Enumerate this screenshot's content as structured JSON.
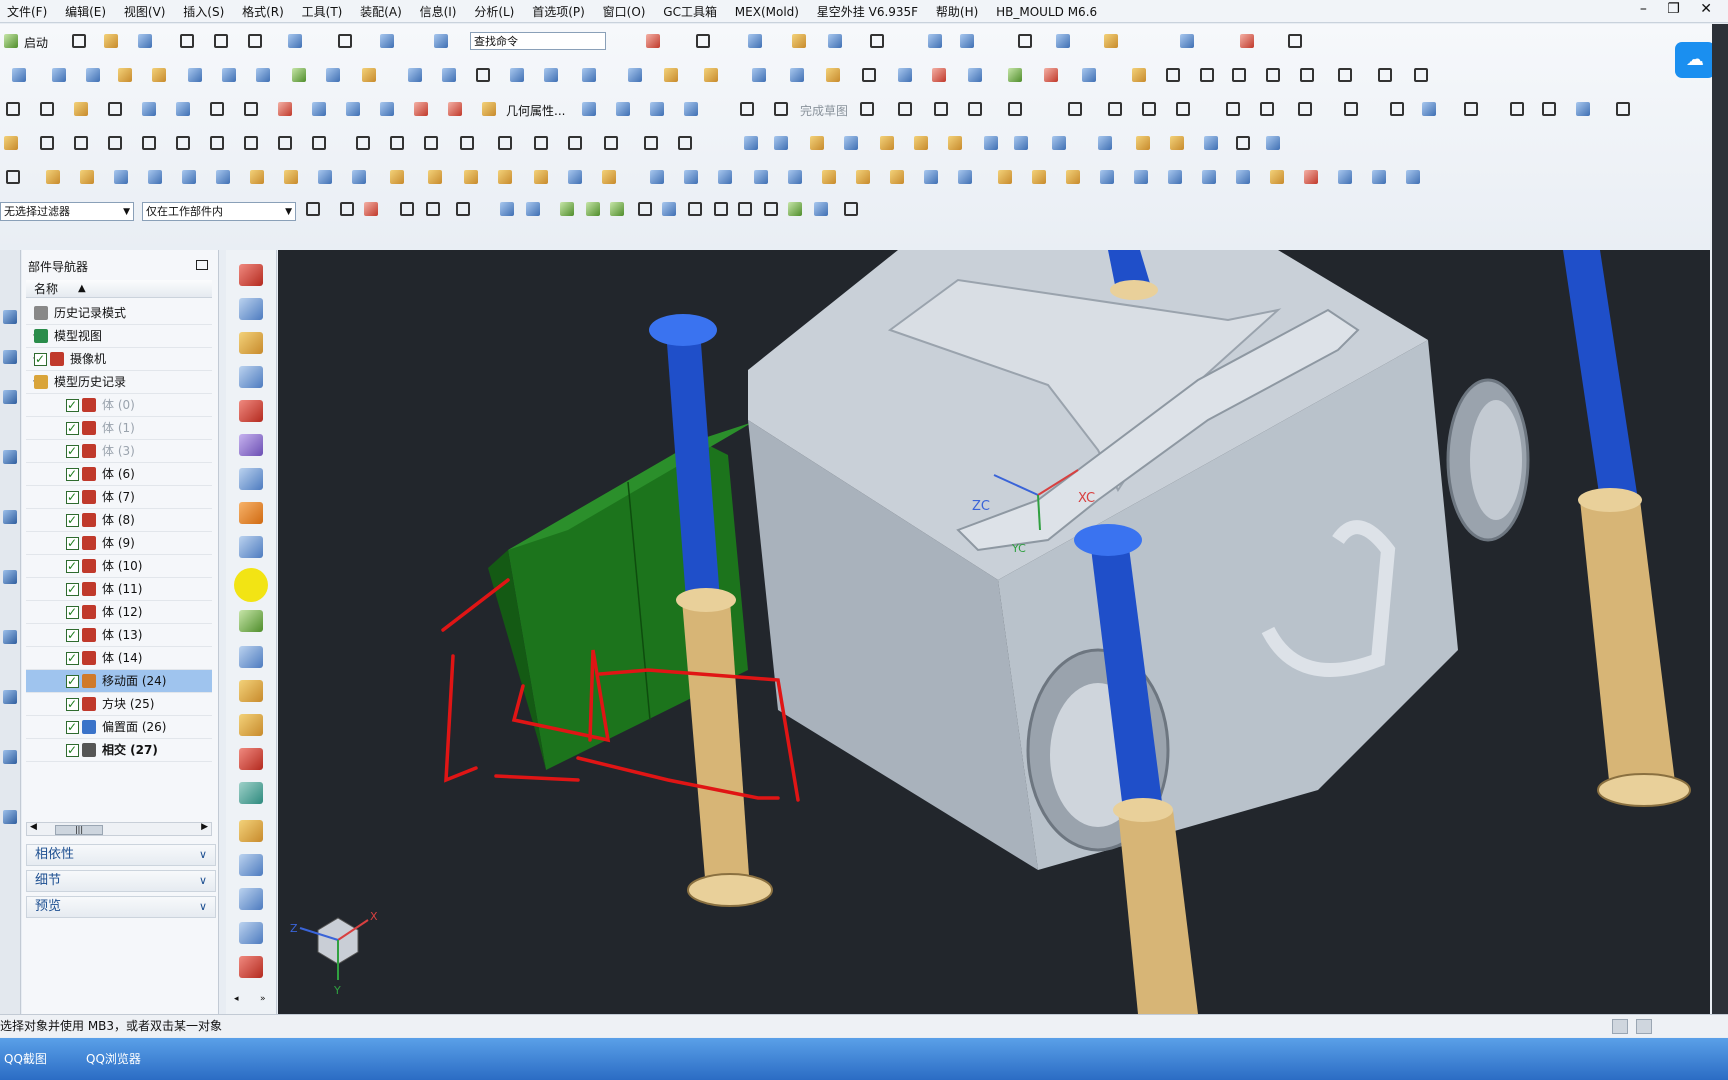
{
  "menu": {
    "items": [
      "文件(F)",
      "编辑(E)",
      "视图(V)",
      "插入(S)",
      "格式(R)",
      "工具(T)",
      "装配(A)",
      "信息(I)",
      "分析(L)",
      "首选项(P)",
      "窗口(O)",
      "GC工具箱",
      "MEX(Mold)",
      "星空外挂 V6.935F",
      "帮助(H)",
      "HB_MOULD M6.6"
    ],
    "window_controls": "– ❐ ✕"
  },
  "toolbar": {
    "start_label": "启动",
    "search_placeholder": "查找命令",
    "geometry_props_label": "几何属性...",
    "finish_sketch_label": "完成草图",
    "filter_select": "无选择过滤器",
    "scope_select": "仅在工作部件内"
  },
  "navigator": {
    "title": "部件导航器",
    "column_header": "名称",
    "sort_arrow": "▲",
    "rows": [
      {
        "label": "历史记录模式",
        "kind": "history",
        "indent": 0,
        "expand": "",
        "check": false,
        "dim": false
      },
      {
        "label": "模型视图",
        "kind": "view",
        "indent": 0,
        "expand": "+",
        "check": false,
        "dim": false
      },
      {
        "label": "摄像机",
        "kind": "camera",
        "indent": 0,
        "expand": "+",
        "check": true,
        "dim": false
      },
      {
        "label": "模型历史记录",
        "kind": "folder",
        "indent": 0,
        "expand": "−",
        "check": false,
        "dim": false
      },
      {
        "label": "体 (0)",
        "kind": "body",
        "indent": 1,
        "check": true,
        "dim": true
      },
      {
        "label": "体 (1)",
        "kind": "body",
        "indent": 1,
        "check": true,
        "dim": true
      },
      {
        "label": "体 (3)",
        "kind": "body",
        "indent": 1,
        "check": true,
        "dim": true
      },
      {
        "label": "体 (6)",
        "kind": "body",
        "indent": 1,
        "check": true,
        "dim": false
      },
      {
        "label": "体 (7)",
        "kind": "body",
        "indent": 1,
        "check": true,
        "dim": false
      },
      {
        "label": "体 (8)",
        "kind": "body",
        "indent": 1,
        "check": true,
        "dim": false
      },
      {
        "label": "体 (9)",
        "kind": "body",
        "indent": 1,
        "check": true,
        "dim": false
      },
      {
        "label": "体 (10)",
        "kind": "body",
        "indent": 1,
        "check": true,
        "dim": false
      },
      {
        "label": "体 (11)",
        "kind": "body",
        "indent": 1,
        "check": true,
        "dim": false
      },
      {
        "label": "体 (12)",
        "kind": "body",
        "indent": 1,
        "check": true,
        "dim": false
      },
      {
        "label": "体 (13)",
        "kind": "body",
        "indent": 1,
        "check": true,
        "dim": false
      },
      {
        "label": "体 (14)",
        "kind": "body",
        "indent": 1,
        "check": true,
        "dim": false
      },
      {
        "label": "移动面 (24)",
        "kind": "move",
        "indent": 1,
        "check": true,
        "dim": false,
        "selected": true
      },
      {
        "label": "方块 (25)",
        "kind": "block",
        "indent": 1,
        "check": true,
        "dim": false
      },
      {
        "label": "偏置面 (26)",
        "kind": "offset",
        "indent": 1,
        "check": true,
        "dim": false
      },
      {
        "label": "相交 (27)",
        "kind": "intersect",
        "indent": 1,
        "check": true,
        "dim": false,
        "bold": true
      }
    ],
    "sections": [
      "相依性",
      "细节",
      "预览"
    ]
  },
  "viewport": {
    "bg_color": "#22262c",
    "axis_labels": {
      "zc": "ZC",
      "xc": "XC",
      "yc": "YC"
    },
    "triad_labels": {
      "x": "X",
      "y": "Y",
      "z": "Z"
    }
  },
  "status": {
    "prompt": "选择对象并使用 MB3，或者双击某一对象"
  },
  "taskbar": {
    "items": [
      "QQ截图",
      "QQ浏览器"
    ]
  },
  "colors": {
    "annotation_red": "#e01515",
    "pin_blue": "#1f4fc9",
    "sleeve_tan": "#d7b576",
    "mold_gray": "#b8c0c8",
    "block_green": "#1f7a1f",
    "accent_blue": "#1a8ff0"
  }
}
